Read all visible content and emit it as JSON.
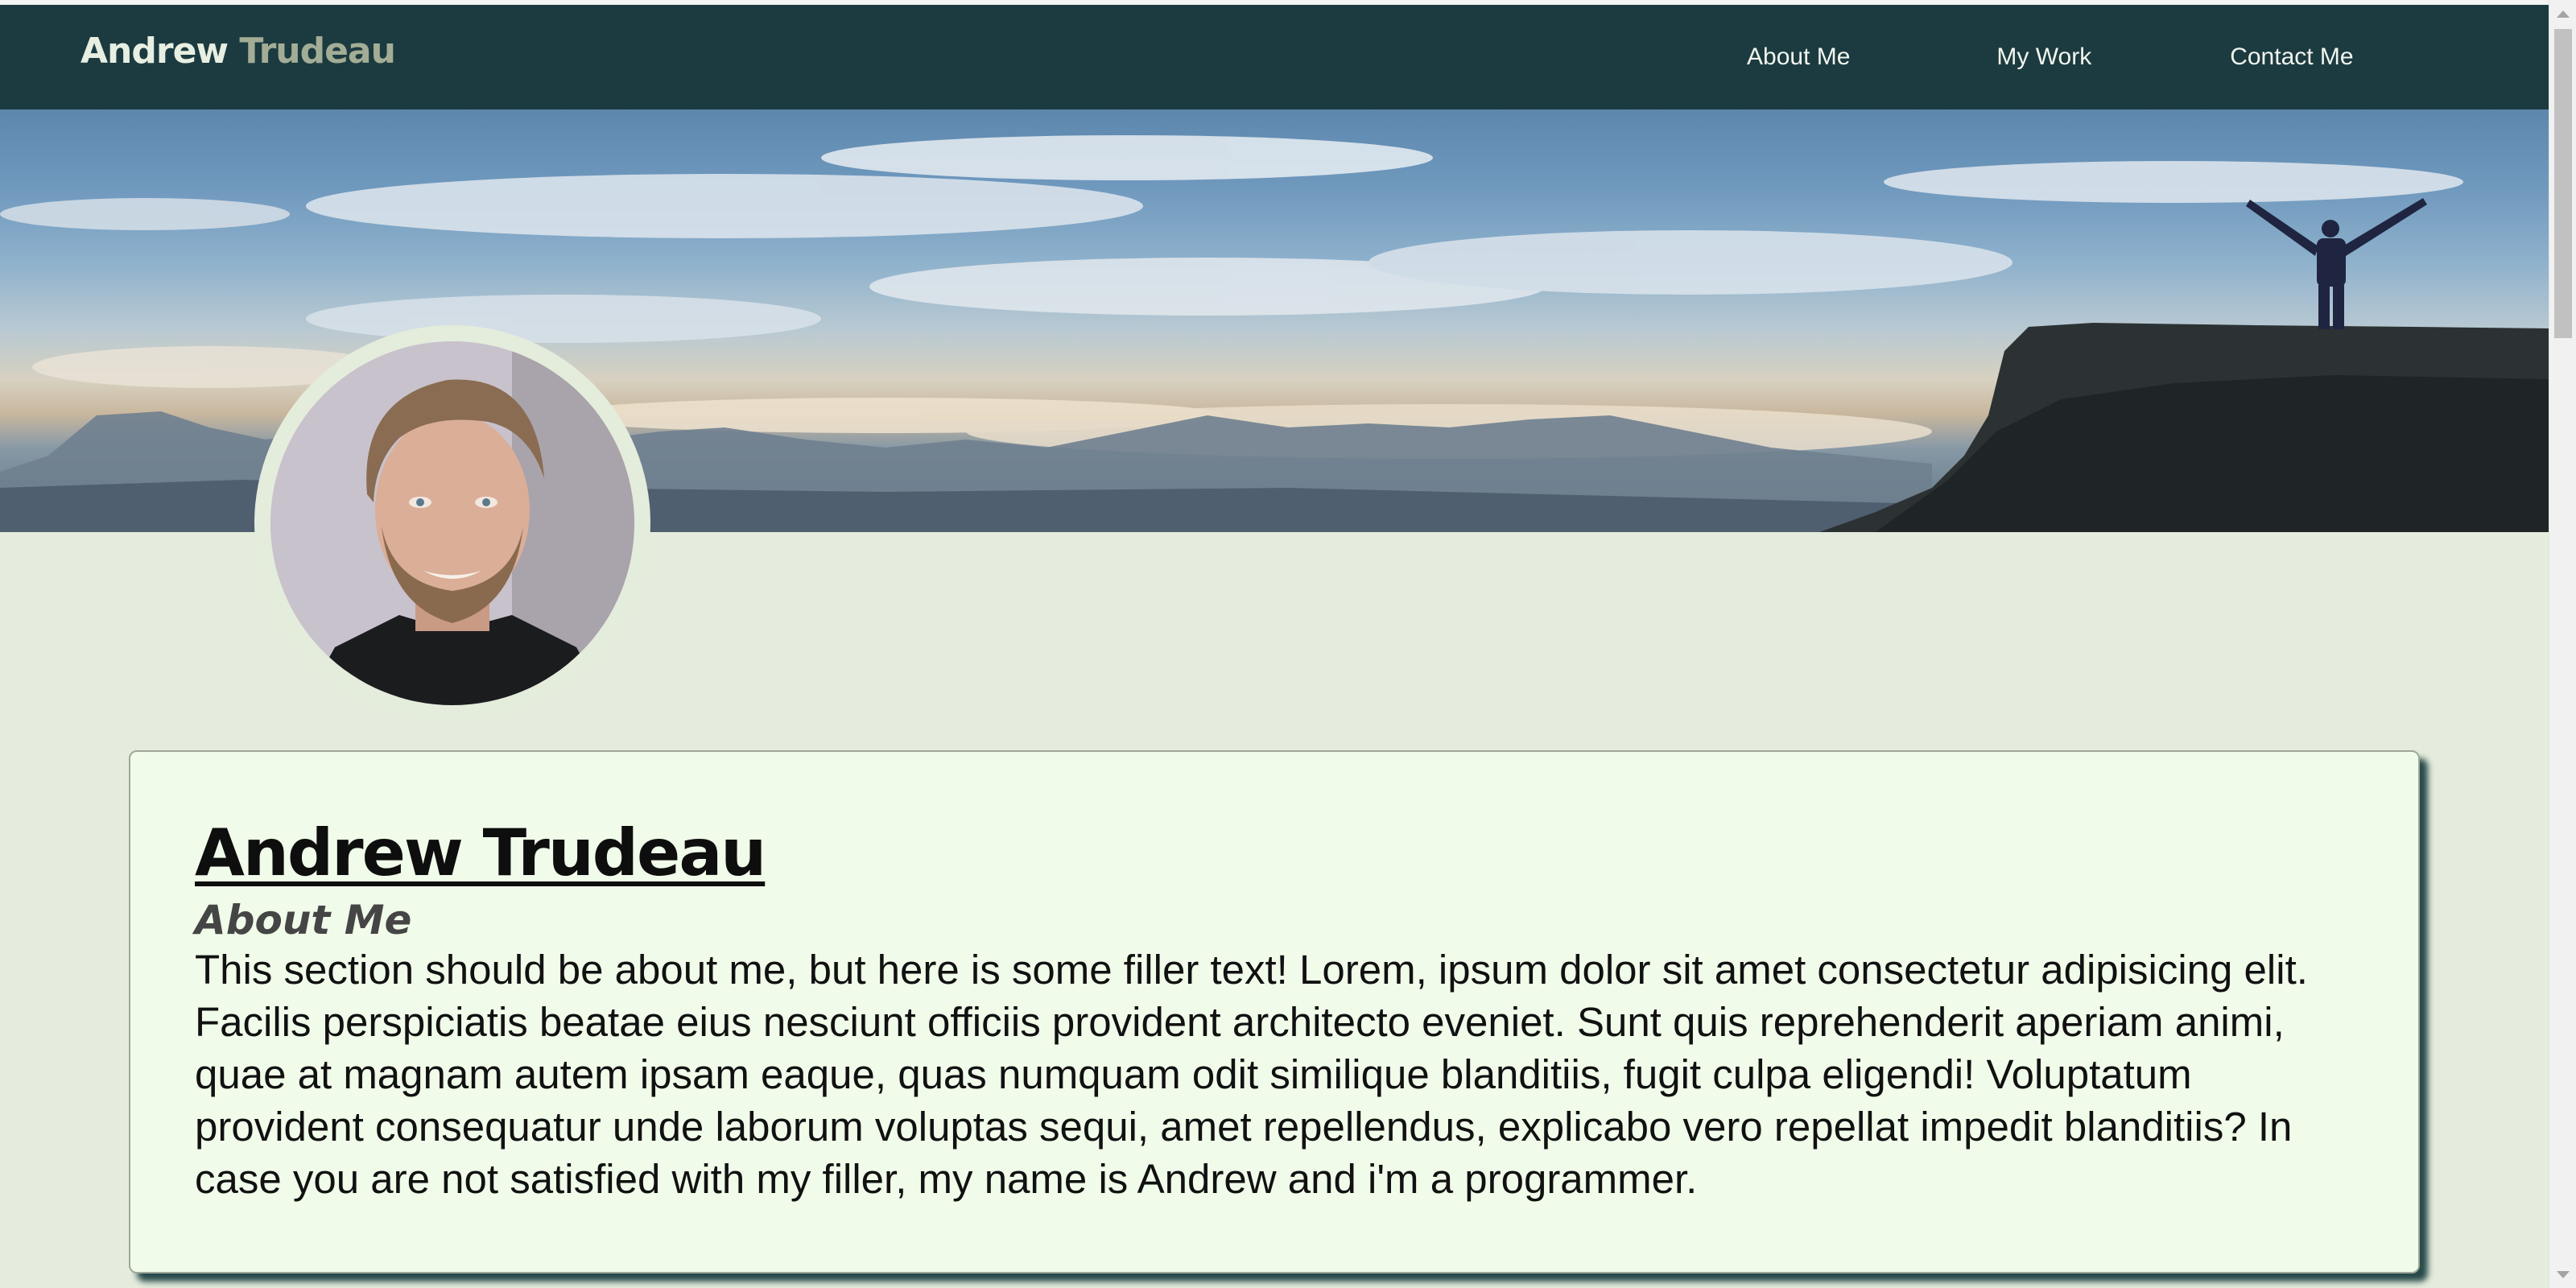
{
  "nav": {
    "brand_first": "Andrew",
    "brand_last": "Trudeau",
    "links": [
      "About Me",
      "My Work",
      "Contact Me"
    ]
  },
  "hero": {
    "description_icon": "landscape-banner"
  },
  "profile": {
    "avatar_icon": "profile-photo"
  },
  "card": {
    "title": "Andrew Trudeau",
    "subtitle": "About Me",
    "body": "This section should be about me, but here is some filler text! Lorem, ipsum dolor sit amet consectetur adipisicing elit. Facilis perspiciatis beatae eius nesciunt officiis provident architecto eveniet. Sunt quis reprehenderit aperiam animi, quae at magnam autem ipsam eaque, quas numquam odit similique blanditiis, fugit culpa eligendi! Voluptatum provident consequatur unde laborum voluptas sequi, amet repellendus, explicabo vero repellat impedit blanditiis? In case you are not satisfied with my filler, my name is Andrew and i'm a programmer."
  },
  "colors": {
    "nav_bg": "#1c3b40",
    "page_bg": "#e5ecdd",
    "card_bg": "#f0fbea",
    "card_shadow": "#284a4a",
    "brand_first": "#e7efe2",
    "brand_last": "#a3ad96"
  }
}
